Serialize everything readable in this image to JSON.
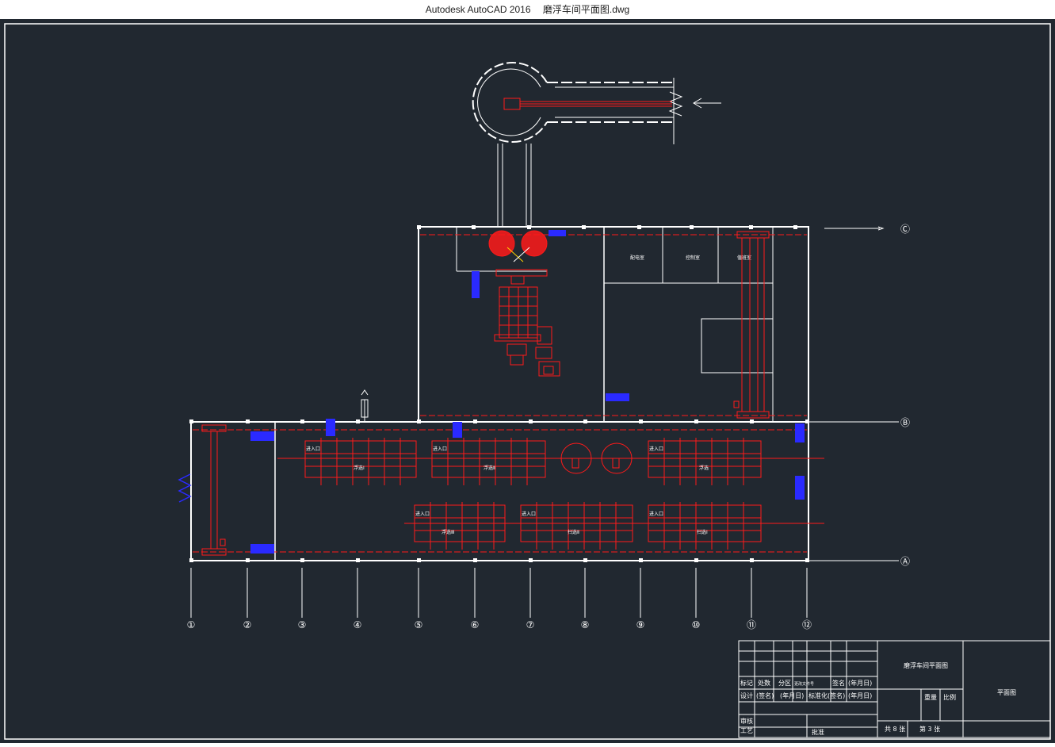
{
  "window": {
    "app_title": "Autodesk AutoCAD 2016",
    "file_name": "磨浮车间平面图.dwg"
  },
  "drawing": {
    "colors": {
      "background": "#212830",
      "white": "#ffffff",
      "red": "#ff1a1a",
      "blue": "#2a2aff"
    },
    "grid_axes": {
      "columns": [
        "①",
        "②",
        "③",
        "④",
        "⑤",
        "⑥",
        "⑦",
        "⑧",
        "⑨",
        "⑩",
        "⑪",
        "⑫"
      ],
      "rows": [
        "Ⓐ",
        "Ⓑ",
        "Ⓒ"
      ]
    },
    "room_labels": [
      "配电室",
      "控制室",
      "值班室"
    ],
    "equipment_labels": [
      "浮选Ⅰ",
      "浮选Ⅱ",
      "浮选",
      "浮选Ⅲ",
      "扫选Ⅱ",
      "扫选Ⅰ"
    ],
    "cell_tag": "进入口",
    "title_block": {
      "drawing_title": "磨浮车间平面图",
      "drawing_type": "平面图",
      "rows": {
        "r1": [
          "标记",
          "处数",
          "分区",
          "更改文件号",
          "签名",
          "(年月日)"
        ],
        "r2": [
          "设计",
          "(签名)",
          "(年月日)",
          "标准化",
          "(签名)",
          "(年月日)"
        ],
        "r3": [
          "审核"
        ],
        "r4": [
          "工艺",
          "批准"
        ],
        "weight_label": "重量",
        "scale_label": "比例",
        "total_sheets": "共 8 张",
        "sheet_no": "第 3 张"
      }
    }
  }
}
